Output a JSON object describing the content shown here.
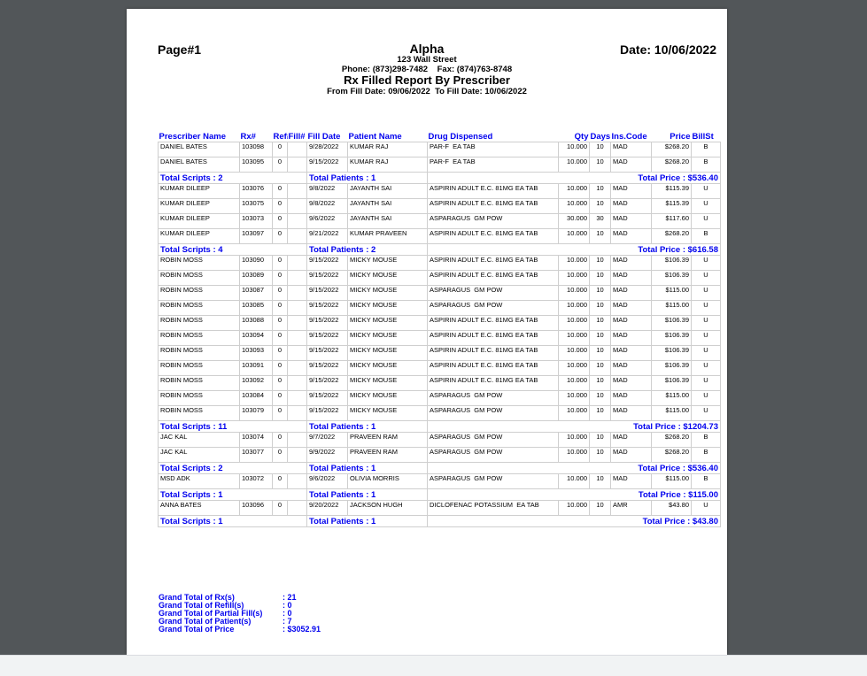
{
  "report": {
    "page_label": "Page#1",
    "pharmacy_name": "Alpha",
    "address": "123 Wall Street",
    "contact": "Phone: (873)298-7482    Fax: (874)763-8748",
    "report_title": "Rx Filled Report By Prescriber",
    "date_range": "From Fill Date: 09/06/2022  To Fill Date: 10/06/2022",
    "date_label": "Date: 10/06/2022"
  },
  "columns": [
    "Prescriber Name",
    "Rx#",
    "Ref#",
    "Fill#",
    "Fill Date",
    "Patient Name",
    "Drug Dispensed",
    "Qty",
    "Days",
    "Ins.Code",
    "Price",
    "BillSt"
  ],
  "groups": [
    {
      "rows": [
        [
          "DANIEL BATES",
          "103098",
          "0",
          "",
          "9/28/2022",
          "KUMAR RAJ",
          "PAR-F  EA TAB",
          "10.000",
          "10",
          "MAD",
          "$268.20",
          "B"
        ],
        [
          "DANIEL BATES",
          "103095",
          "0",
          "",
          "9/15/2022",
          "KUMAR RAJ",
          "PAR-F  EA TAB",
          "10.000",
          "10",
          "MAD",
          "$268.20",
          "B"
        ]
      ],
      "total_scripts": "Total Scripts : 2",
      "total_patients": "Total Patients : 1",
      "total_price": "Total Price : $536.40"
    },
    {
      "rows": [
        [
          "KUMAR DILEEP",
          "103076",
          "0",
          "",
          "9/8/2022",
          "JAYANTH SAI",
          "ASPIRIN ADULT E.C. 81MG EA TAB",
          "10.000",
          "10",
          "MAD",
          "$115.39",
          "U"
        ],
        [
          "KUMAR DILEEP",
          "103075",
          "0",
          "",
          "9/8/2022",
          "JAYANTH SAI",
          "ASPIRIN ADULT E.C. 81MG EA TAB",
          "10.000",
          "10",
          "MAD",
          "$115.39",
          "U"
        ],
        [
          "KUMAR DILEEP",
          "103073",
          "0",
          "",
          "9/6/2022",
          "JAYANTH SAI",
          "ASPARAGUS  GM POW",
          "30.000",
          "30",
          "MAD",
          "$117.60",
          "U"
        ],
        [
          "KUMAR DILEEP",
          "103097",
          "0",
          "",
          "9/21/2022",
          "KUMAR PRAVEEN",
          "ASPIRIN ADULT E.C. 81MG EA TAB",
          "10.000",
          "10",
          "MAD",
          "$268.20",
          "B"
        ]
      ],
      "total_scripts": "Total Scripts : 4",
      "total_patients": "Total Patients : 2",
      "total_price": "Total Price : $616.58"
    },
    {
      "rows": [
        [
          "ROBIN MOSS",
          "103090",
          "0",
          "",
          "9/15/2022",
          "MICKY MOUSE",
          "ASPIRIN ADULT E.C. 81MG EA TAB",
          "10.000",
          "10",
          "MAD",
          "$106.39",
          "U"
        ],
        [
          "ROBIN MOSS",
          "103089",
          "0",
          "",
          "9/15/2022",
          "MICKY MOUSE",
          "ASPIRIN ADULT E.C. 81MG EA TAB",
          "10.000",
          "10",
          "MAD",
          "$106.39",
          "U"
        ],
        [
          "ROBIN MOSS",
          "103087",
          "0",
          "",
          "9/15/2022",
          "MICKY MOUSE",
          "ASPARAGUS  GM POW",
          "10.000",
          "10",
          "MAD",
          "$115.00",
          "U"
        ],
        [
          "ROBIN MOSS",
          "103085",
          "0",
          "",
          "9/15/2022",
          "MICKY MOUSE",
          "ASPARAGUS  GM POW",
          "10.000",
          "10",
          "MAD",
          "$115.00",
          "U"
        ],
        [
          "ROBIN MOSS",
          "103088",
          "0",
          "",
          "9/15/2022",
          "MICKY MOUSE",
          "ASPIRIN ADULT E.C. 81MG EA TAB",
          "10.000",
          "10",
          "MAD",
          "$106.39",
          "U"
        ],
        [
          "ROBIN MOSS",
          "103094",
          "0",
          "",
          "9/15/2022",
          "MICKY MOUSE",
          "ASPIRIN ADULT E.C. 81MG EA TAB",
          "10.000",
          "10",
          "MAD",
          "$106.39",
          "U"
        ],
        [
          "ROBIN MOSS",
          "103093",
          "0",
          "",
          "9/15/2022",
          "MICKY MOUSE",
          "ASPIRIN ADULT E.C. 81MG EA TAB",
          "10.000",
          "10",
          "MAD",
          "$106.39",
          "U"
        ],
        [
          "ROBIN MOSS",
          "103091",
          "0",
          "",
          "9/15/2022",
          "MICKY MOUSE",
          "ASPIRIN ADULT E.C. 81MG EA TAB",
          "10.000",
          "10",
          "MAD",
          "$106.39",
          "U"
        ],
        [
          "ROBIN MOSS",
          "103092",
          "0",
          "",
          "9/15/2022",
          "MICKY MOUSE",
          "ASPIRIN ADULT E.C. 81MG EA TAB",
          "10.000",
          "10",
          "MAD",
          "$106.39",
          "U"
        ],
        [
          "ROBIN MOSS",
          "103084",
          "0",
          "",
          "9/15/2022",
          "MICKY MOUSE",
          "ASPARAGUS  GM POW",
          "10.000",
          "10",
          "MAD",
          "$115.00",
          "U"
        ],
        [
          "ROBIN MOSS",
          "103079",
          "0",
          "",
          "9/15/2022",
          "MICKY MOUSE",
          "ASPARAGUS  GM POW",
          "10.000",
          "10",
          "MAD",
          "$115.00",
          "U"
        ]
      ],
      "total_scripts": "Total Scripts : 11",
      "total_patients": "Total Patients : 1",
      "total_price": "Total Price : $1204.73"
    },
    {
      "rows": [
        [
          "JAC KAL",
          "103074",
          "0",
          "",
          "9/7/2022",
          "PRAVEEN RAM",
          "ASPARAGUS  GM POW",
          "10.000",
          "10",
          "MAD",
          "$268.20",
          "B"
        ],
        [
          "JAC KAL",
          "103077",
          "0",
          "",
          "9/9/2022",
          "PRAVEEN RAM",
          "ASPARAGUS  GM POW",
          "10.000",
          "10",
          "MAD",
          "$268.20",
          "B"
        ]
      ],
      "total_scripts": "Total Scripts : 2",
      "total_patients": "Total Patients : 1",
      "total_price": "Total Price : $536.40"
    },
    {
      "rows": [
        [
          "MSD ADK",
          "103072",
          "0",
          "",
          "9/6/2022",
          "OLIVIA MORRIS",
          "ASPARAGUS  GM POW",
          "10.000",
          "10",
          "MAD",
          "$115.00",
          "B"
        ]
      ],
      "total_scripts": "Total Scripts : 1",
      "total_patients": "Total Patients : 1",
      "total_price": "Total Price : $115.00"
    },
    {
      "rows": [
        [
          "ANNA BATES",
          "103096",
          "0",
          "",
          "9/20/2022",
          "JACKSON HUGH",
          "DICLOFENAC POTASSIUM  EA TAB",
          "10.000",
          "10",
          "AMR",
          "$43.80",
          "U"
        ]
      ],
      "total_scripts": "Total Scripts : 1",
      "total_patients": "Total Patients : 1",
      "total_price": "Total Price : $43.80"
    }
  ],
  "grand_totals": [
    {
      "label": "Grand Total of Rx(s)",
      "value": ": 21"
    },
    {
      "label": "Grand Total of Refill(s)",
      "value": ": 0"
    },
    {
      "label": "Grand Total of Partial Fill(s)",
      "value": ": 0"
    },
    {
      "label": "Grand Total of Patient(s)",
      "value": ": 7"
    },
    {
      "label": "Grand Total of Price",
      "value": ": $3052.91"
    }
  ]
}
